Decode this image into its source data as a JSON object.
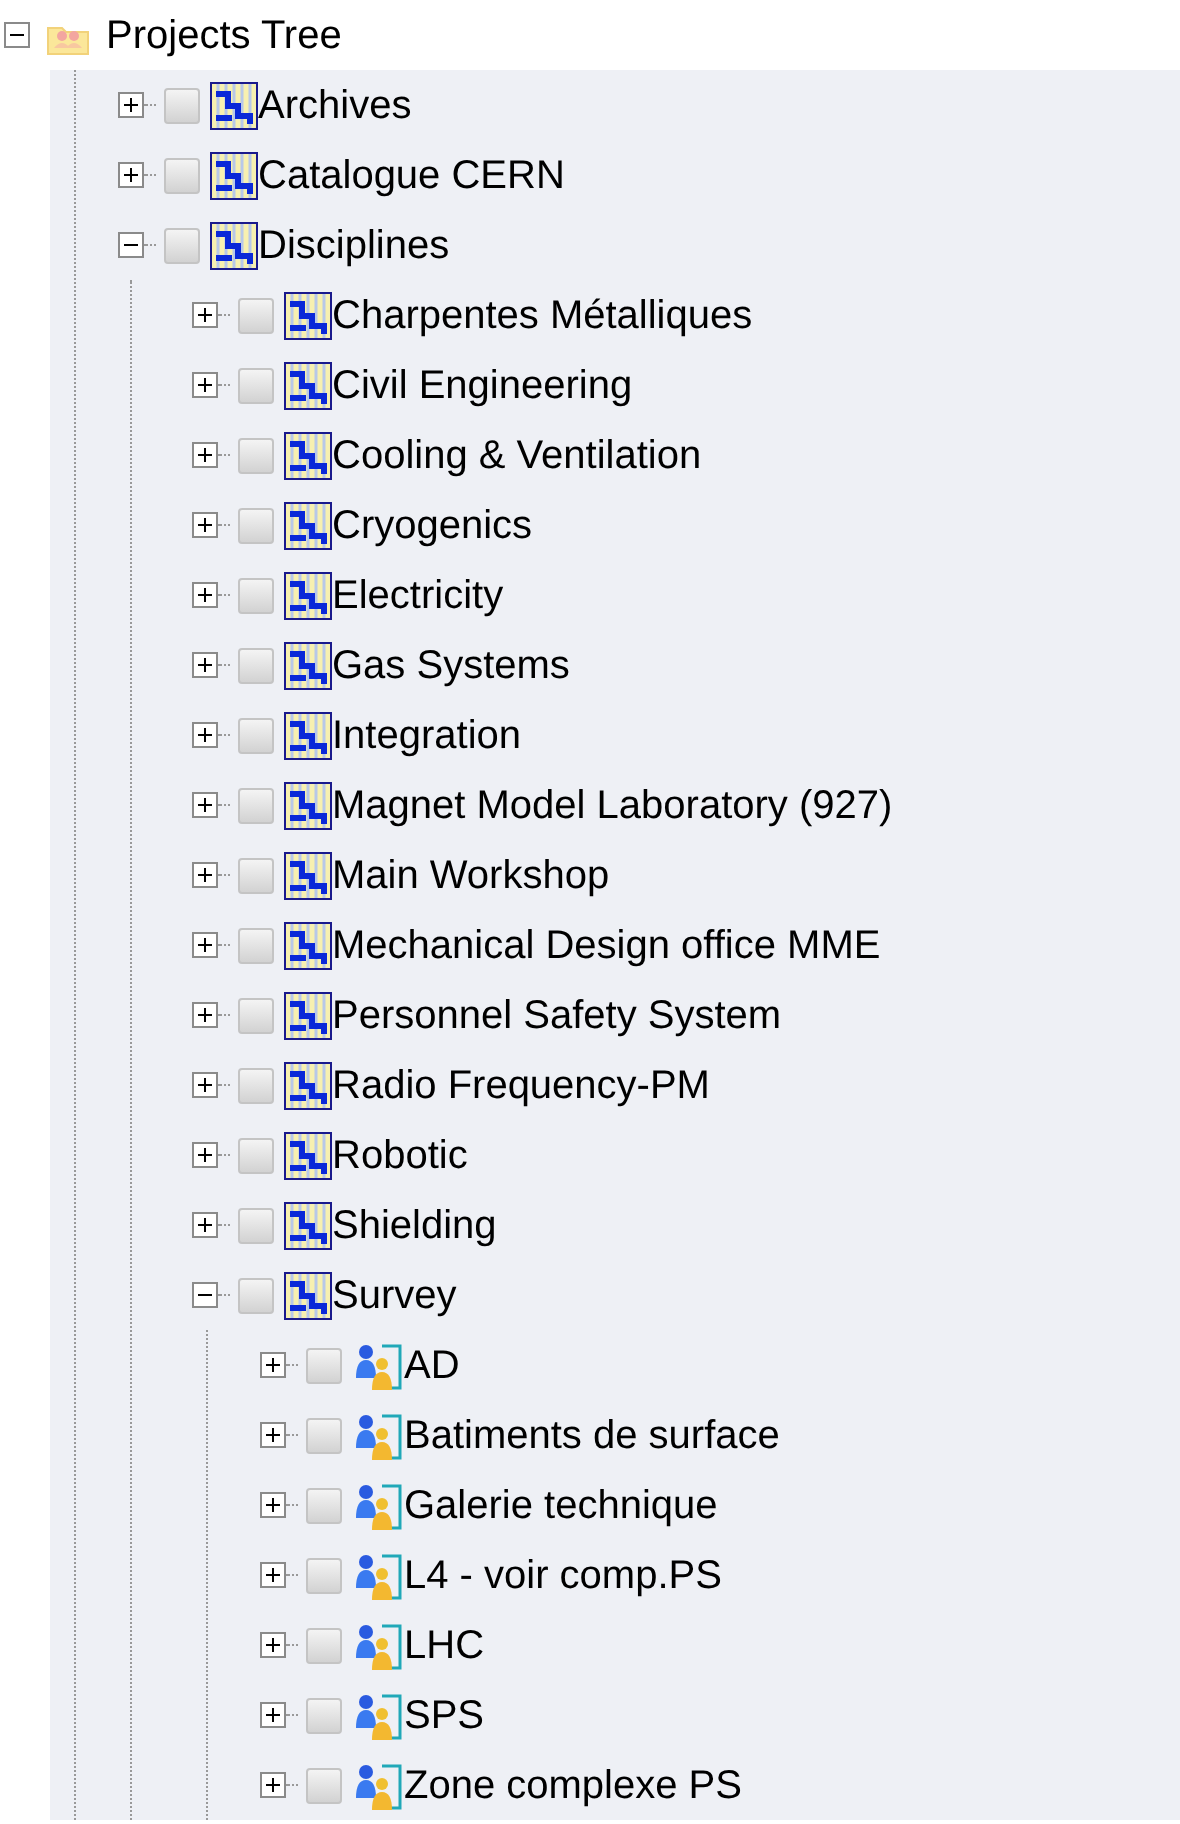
{
  "tree": {
    "label": "Projects Tree",
    "kind": "root",
    "expanded": true,
    "children": [
      {
        "label": "Archives",
        "kind": "project",
        "expanded": false,
        "checked": false
      },
      {
        "label": "Catalogue CERN",
        "kind": "project",
        "expanded": false,
        "checked": false
      },
      {
        "label": "Disciplines",
        "kind": "project",
        "expanded": true,
        "checked": false,
        "children": [
          {
            "label": "Charpentes Métalliques",
            "kind": "project",
            "expanded": false,
            "checked": false
          },
          {
            "label": "Civil Engineering",
            "kind": "project",
            "expanded": false,
            "checked": false
          },
          {
            "label": "Cooling & Ventilation",
            "kind": "project",
            "expanded": false,
            "checked": false
          },
          {
            "label": "Cryogenics",
            "kind": "project",
            "expanded": false,
            "checked": false
          },
          {
            "label": "Electricity",
            "kind": "project",
            "expanded": false,
            "checked": false
          },
          {
            "label": "Gas Systems",
            "kind": "project",
            "expanded": false,
            "checked": false
          },
          {
            "label": "Integration",
            "kind": "project",
            "expanded": false,
            "checked": false
          },
          {
            "label": "Magnet Model Laboratory (927)",
            "kind": "project",
            "expanded": false,
            "checked": false
          },
          {
            "label": "Main Workshop",
            "kind": "project",
            "expanded": false,
            "checked": false
          },
          {
            "label": "Mechanical Design office MME",
            "kind": "project",
            "expanded": false,
            "checked": false
          },
          {
            "label": "Personnel Safety System",
            "kind": "project",
            "expanded": false,
            "checked": false
          },
          {
            "label": "Radio Frequency-PM",
            "kind": "project",
            "expanded": false,
            "checked": false
          },
          {
            "label": "Robotic",
            "kind": "project",
            "expanded": false,
            "checked": false
          },
          {
            "label": "Shielding",
            "kind": "project",
            "expanded": false,
            "checked": false
          },
          {
            "label": "Survey",
            "kind": "project",
            "expanded": true,
            "checked": false,
            "children": [
              {
                "label": "AD",
                "kind": "group",
                "expanded": false,
                "checked": false
              },
              {
                "label": "Batiments de surface",
                "kind": "group",
                "expanded": false,
                "checked": false
              },
              {
                "label": "Galerie technique",
                "kind": "group",
                "expanded": false,
                "checked": false
              },
              {
                "label": "L4 - voir comp.PS",
                "kind": "group",
                "expanded": false,
                "checked": false
              },
              {
                "label": "LHC",
                "kind": "group",
                "expanded": false,
                "checked": false
              },
              {
                "label": "SPS",
                "kind": "group",
                "expanded": false,
                "checked": false
              },
              {
                "label": "Zone complexe PS",
                "kind": "group",
                "expanded": false,
                "checked": false
              }
            ]
          }
        ]
      }
    ]
  }
}
